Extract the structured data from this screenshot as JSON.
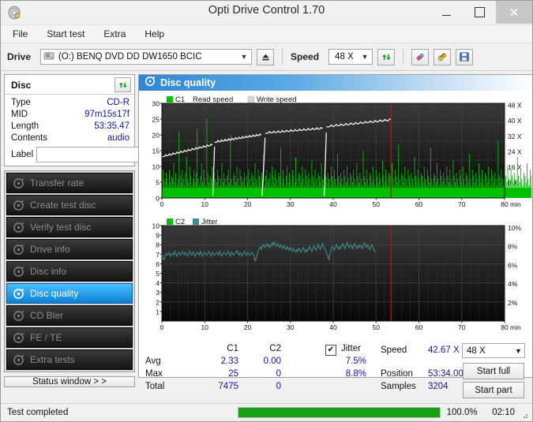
{
  "window": {
    "title": "Opti Drive Control 1.70",
    "icon": "disc-icon",
    "minimize": "minimize-icon",
    "maximize": "maximize-icon",
    "close": "✕"
  },
  "menu": {
    "items": [
      {
        "label": "File"
      },
      {
        "label": "Start test"
      },
      {
        "label": "Extra"
      },
      {
        "label": "Help"
      }
    ]
  },
  "toolbar": {
    "drive_label": "Drive",
    "drive_value": "(O:)  BENQ DVD DD DW1650 BCIC",
    "eject_icon": "eject-icon",
    "speed_label": "Speed",
    "speed_value": "48 X",
    "refresh_icon": "refresh-icon",
    "eraser_icon": "eraser-icon",
    "tools_icon": "tools-icon",
    "save_icon": "save-icon"
  },
  "disc": {
    "header": "Disc",
    "refresh_icon": "refresh-icon",
    "rows": [
      {
        "key": "Type",
        "value": "CD-R"
      },
      {
        "key": "MID",
        "value": "97m15s17f"
      },
      {
        "key": "Length",
        "value": "53:35.47"
      },
      {
        "key": "Contents",
        "value": "audio"
      }
    ],
    "label_key": "Label",
    "label_value": "",
    "label_button_icon": "cd-icon"
  },
  "sidebar": {
    "items": [
      {
        "label": "Transfer rate",
        "icon": "disc-icon",
        "selected": false
      },
      {
        "label": "Create test disc",
        "icon": "disc-icon",
        "selected": false
      },
      {
        "label": "Verify test disc",
        "icon": "disc-icon",
        "selected": false
      },
      {
        "label": "Drive info",
        "icon": "disc-icon",
        "selected": false
      },
      {
        "label": "Disc info",
        "icon": "disc-icon",
        "selected": false
      },
      {
        "label": "Disc quality",
        "icon": "disc-icon",
        "selected": true
      },
      {
        "label": "CD Bler",
        "icon": "disc-icon",
        "selected": false
      },
      {
        "label": "FE / TE",
        "icon": "disc-icon",
        "selected": false
      },
      {
        "label": "Extra tests",
        "icon": "disc-icon",
        "selected": false
      }
    ],
    "status_window_button": "Status window > >"
  },
  "panel": {
    "title": "Disc quality",
    "icon": "disc-icon"
  },
  "stats": {
    "col_c1": "C1",
    "col_c2": "C2",
    "jitter_label": "Jitter",
    "jitter_checked": true,
    "rows": [
      {
        "name": "Avg",
        "c1": "2.33",
        "c2": "0.00",
        "jitter": "7.5%"
      },
      {
        "name": "Max",
        "c1": "25",
        "c2": "0",
        "jitter": "8.8%"
      },
      {
        "name": "Total",
        "c1": "7475",
        "c2": "0",
        "jitter": ""
      }
    ],
    "speed_label": "Speed",
    "speed_value": "42.67 X",
    "position_label": "Position",
    "position_value": "53:34.00",
    "samples_label": "Samples",
    "samples_value": "3204",
    "speed_select": "48 X",
    "start_full": "Start full",
    "start_part": "Start part"
  },
  "statusbar": {
    "message": "Test completed",
    "progress_percent": 100,
    "progress_text": "100.0%",
    "elapsed": "02:10"
  },
  "colors": {
    "c1_green": "#00c000",
    "jitter_teal": "#3f8c8c",
    "read_speed_white": "#ffffff",
    "write_speed_gray": "#d8d8d8",
    "marker_red": "#e00000",
    "accent_blue": "#2f86d4",
    "value_blue": "#1414a0",
    "progress_green": "#16a016"
  },
  "chart_data": [
    {
      "type": "area",
      "name": "c1-chart",
      "title": "",
      "xlabel": "min",
      "ylabel": "",
      "xlim": [
        0,
        80
      ],
      "ylim": [
        0,
        30
      ],
      "xticks": [
        0,
        10,
        20,
        30,
        40,
        50,
        60,
        70,
        80
      ],
      "xtick_suffix": "min",
      "yticks": [
        0,
        5,
        10,
        15,
        20,
        25,
        30
      ],
      "y2ticks": [
        "8 X",
        "16 X",
        "24 X",
        "32 X",
        "40 X",
        "48 X"
      ],
      "y2lim": [
        0,
        52
      ],
      "grid": true,
      "legend": [
        {
          "label": "C1",
          "color": "#00c000",
          "swatch": true
        },
        {
          "label": "Read speed",
          "color": "#ffffff",
          "swatch": false
        },
        {
          "label": "Write speed",
          "color": "#d8d8d8",
          "swatch": true
        }
      ],
      "marker_x": 53.5,
      "data_end_x": 53.8,
      "series": [
        {
          "name": "C1",
          "type": "area",
          "color": "#00c000",
          "x_step": 0.25,
          "values": [
            7,
            9,
            6,
            5,
            8,
            6,
            4,
            9,
            5,
            7,
            6,
            11,
            5,
            8,
            4,
            6,
            21,
            7,
            5,
            9,
            6,
            4,
            8,
            13,
            6,
            5,
            10,
            7,
            4,
            6,
            9,
            5,
            8,
            22,
            6,
            4,
            7,
            11,
            5,
            9,
            6,
            4,
            25,
            8,
            5,
            7,
            6,
            10,
            4,
            8,
            6,
            5,
            9,
            7,
            4,
            6,
            11,
            5,
            8,
            6,
            4,
            7,
            9,
            5,
            20,
            6,
            4,
            8,
            7,
            5,
            10,
            6,
            4,
            9,
            7,
            5,
            6,
            8,
            4,
            7,
            5,
            9,
            6,
            4,
            8,
            7,
            5,
            11,
            6,
            4,
            9,
            7,
            5,
            8,
            6,
            14,
            4,
            7,
            9,
            5,
            6,
            8,
            4,
            10,
            7,
            5,
            9,
            6,
            4,
            8,
            7,
            16,
            5,
            9,
            6,
            4,
            7,
            10,
            5,
            8,
            6,
            4,
            9,
            7,
            5,
            13,
            6,
            4,
            8,
            7,
            5,
            10,
            6,
            4,
            9,
            7,
            5,
            8,
            6,
            4,
            12,
            7,
            5,
            9,
            6,
            4,
            8,
            7,
            5,
            11,
            6,
            4,
            9,
            7,
            5,
            8,
            6,
            4,
            10,
            7,
            5,
            9,
            6,
            4,
            14,
            7,
            5,
            8,
            6,
            4,
            9,
            7,
            5,
            10,
            6,
            4,
            8,
            7,
            5,
            9,
            6,
            4,
            11,
            7,
            5,
            8,
            6,
            4,
            15,
            7,
            5,
            9,
            6,
            4,
            8,
            7,
            5,
            10,
            6,
            4,
            9,
            7,
            5,
            8,
            6,
            4,
            12,
            7,
            5,
            9,
            6,
            4,
            8,
            7,
            5,
            11,
            6,
            4,
            9,
            7,
            5,
            17,
            6,
            4,
            8,
            7,
            5,
            10,
            6,
            4,
            9,
            7,
            5,
            8,
            6,
            4,
            13,
            7,
            5,
            9,
            6,
            4,
            8,
            7,
            5,
            10,
            6,
            4,
            9,
            7,
            5,
            16,
            6,
            4,
            8,
            7,
            5,
            11,
            6,
            4,
            9,
            7,
            5,
            8,
            6,
            4,
            10,
            7,
            5,
            9,
            6,
            4,
            12,
            7,
            5,
            8,
            6,
            4,
            9,
            7,
            5,
            10,
            6,
            4,
            8,
            7,
            5,
            14,
            6,
            4,
            9,
            7,
            5,
            8,
            6,
            4,
            11,
            7,
            5,
            9,
            6,
            4,
            8,
            7,
            5,
            10,
            6,
            4,
            9,
            7,
            5,
            8,
            6,
            4,
            18,
            7,
            5,
            9,
            6,
            4,
            8,
            7,
            5,
            10,
            6,
            4,
            9,
            7,
            5,
            8,
            6,
            4,
            13,
            7,
            5,
            9,
            6,
            4,
            8,
            7,
            5,
            11,
            6,
            4,
            9,
            7,
            5,
            8,
            6,
            4,
            10,
            7,
            5,
            9,
            6,
            4,
            12,
            7,
            5,
            8,
            6,
            4,
            9,
            7,
            5,
            10,
            6,
            4,
            8,
            7,
            5,
            9,
            6,
            4,
            15,
            7,
            5,
            8,
            6,
            4,
            10,
            7,
            5,
            9,
            6,
            4,
            8,
            7,
            5,
            11,
            6,
            4,
            9,
            7,
            5,
            8,
            6,
            4,
            10,
            7,
            5,
            9,
            6,
            4,
            8,
            7,
            5,
            13,
            6,
            4,
            9,
            7,
            5,
            8,
            6,
            4,
            11,
            7,
            5,
            9,
            6,
            4,
            8,
            7,
            5,
            10,
            6,
            4,
            9,
            7,
            5,
            8,
            6,
            4,
            12,
            7,
            5,
            9,
            6,
            4,
            8,
            7,
            5,
            10,
            6,
            4,
            9,
            7,
            5,
            8,
            6,
            4,
            14,
            7,
            5,
            9,
            6,
            4,
            8,
            7,
            5,
            11,
            6,
            4,
            9,
            7,
            5,
            8,
            6,
            4,
            10,
            7,
            5,
            9,
            6,
            4,
            8,
            7,
            5,
            12,
            6,
            4,
            9,
            7,
            5,
            8,
            6,
            4,
            11,
            7,
            5,
            9,
            6,
            4,
            8,
            7,
            5,
            10,
            6,
            4,
            9,
            7,
            5,
            8,
            6,
            4,
            13,
            7,
            5,
            9,
            6,
            4,
            8,
            7,
            5,
            17,
            9,
            12,
            22,
            27,
            20,
            14,
            9,
            11,
            7,
            15,
            6,
            9,
            7,
            5
          ]
        },
        {
          "name": "Read speed",
          "type": "line",
          "color": "#ffffff",
          "axis": "y2",
          "segments": [
            {
              "x_start": 0,
              "x_end": 11.8,
              "y_start": 22.5,
              "y_end": 29.0
            },
            {
              "x_start": 11.9,
              "x_end": 12.3,
              "y_start": 1.0,
              "y_end": 28.0
            },
            {
              "x_start": 12.3,
              "x_end": 23.2,
              "y_start": 30.5,
              "y_end": 34.5
            },
            {
              "x_start": 23.4,
              "x_end": 24.1,
              "y_start": 1.0,
              "y_end": 33.0
            },
            {
              "x_start": 24.1,
              "x_end": 37.5,
              "y_start": 35.5,
              "y_end": 38.0
            },
            {
              "x_start": 37.9,
              "x_end": 38.4,
              "y_start": 1.0,
              "y_end": 36.0
            },
            {
              "x_start": 38.4,
              "x_end": 53.6,
              "y_start": 39.0,
              "y_end": 42.7
            }
          ]
        }
      ]
    },
    {
      "type": "line",
      "name": "jitter-chart",
      "title": "",
      "xlabel": "min",
      "xlim": [
        0,
        80
      ],
      "ylim": [
        0,
        10
      ],
      "xticks": [
        0,
        10,
        20,
        30,
        40,
        50,
        60,
        70,
        80
      ],
      "xtick_suffix": "min",
      "yticks": [
        1,
        2,
        3,
        4,
        5,
        6,
        7,
        8,
        9,
        10
      ],
      "y2ticks": [
        "2%",
        "4%",
        "6%",
        "8%",
        "10%"
      ],
      "grid": true,
      "legend": [
        {
          "label": "C2",
          "color": "#00c000",
          "swatch": true
        },
        {
          "label": "Jitter",
          "color": "#3f8c8c",
          "swatch": true
        }
      ],
      "marker_x": 53.5,
      "series": [
        {
          "name": "C2",
          "type": "area",
          "color": "#00c000",
          "values": []
        },
        {
          "name": "Jitter",
          "type": "line",
          "color": "#3f8c8c",
          "x_step": 0.25,
          "values": [
            7.2,
            6.6,
            6.4,
            6.8,
            7.1,
            6.9,
            7.0,
            7.2,
            6.8,
            7.0,
            7.1,
            6.9,
            7.3,
            7.0,
            6.8,
            7.1,
            7.2,
            6.9,
            7.0,
            7.3,
            7.1,
            6.9,
            7.2,
            7.0,
            6.8,
            7.1,
            7.3,
            7.0,
            6.9,
            7.2,
            7.1,
            6.8,
            7.0,
            7.2,
            7.1,
            6.9,
            7.3,
            7.0,
            6.8,
            7.1,
            7.2,
            7.0,
            6.9,
            7.1,
            7.3,
            7.0,
            6.8,
            7.2,
            7.1,
            6.9,
            7.0,
            7.2,
            7.1,
            6.9,
            7.3,
            7.0,
            6.8,
            7.1,
            7.2,
            7.0,
            6.9,
            7.1,
            7.3,
            7.0,
            6.8,
            7.2,
            7.1,
            6.9,
            7.0,
            7.2,
            7.4,
            7.1,
            6.9,
            7.2,
            7.0,
            6.8,
            7.1,
            7.3,
            7.0,
            6.9,
            7.2,
            7.1,
            6.9,
            7.0,
            7.2,
            7.1,
            6.8,
            6.3,
            6.5,
            7.0,
            7.4,
            7.6,
            7.8,
            7.5,
            7.9,
            8.0,
            7.7,
            7.9,
            8.1,
            7.8,
            8.0,
            7.7,
            7.9,
            8.2,
            7.9,
            8.3,
            8.0,
            7.8,
            8.1,
            7.9,
            7.7,
            8.0,
            7.8,
            7.6,
            7.9,
            7.7,
            7.5,
            7.8,
            7.6,
            7.4,
            7.7,
            7.5,
            7.3,
            7.6,
            7.4,
            7.2,
            7.5,
            7.3,
            7.6,
            7.4,
            7.2,
            7.5,
            7.7,
            7.4,
            7.2,
            7.5,
            7.3,
            7.6,
            7.8,
            7.5,
            7.3,
            7.6,
            7.9,
            7.6,
            7.4,
            7.7,
            8.0,
            7.7,
            7.5,
            7.8,
            8.1,
            7.8,
            7.6,
            7.4,
            7.1,
            6.8,
            6.4,
            7.0,
            7.5,
            7.8,
            7.6,
            7.4,
            7.7,
            8.0,
            7.7,
            7.5,
            7.8,
            7.6,
            7.9,
            8.1,
            7.8,
            7.6,
            7.9,
            8.2,
            7.9,
            7.7,
            8.0,
            7.8,
            7.6,
            7.9,
            8.1,
            7.8,
            7.6,
            7.9,
            7.7,
            8.0,
            7.8,
            7.6,
            7.9,
            8.2,
            7.9,
            7.7,
            8.0,
            7.8,
            7.5,
            7.8,
            8.0,
            7.7,
            7.5,
            7.2
          ]
        }
      ]
    }
  ]
}
